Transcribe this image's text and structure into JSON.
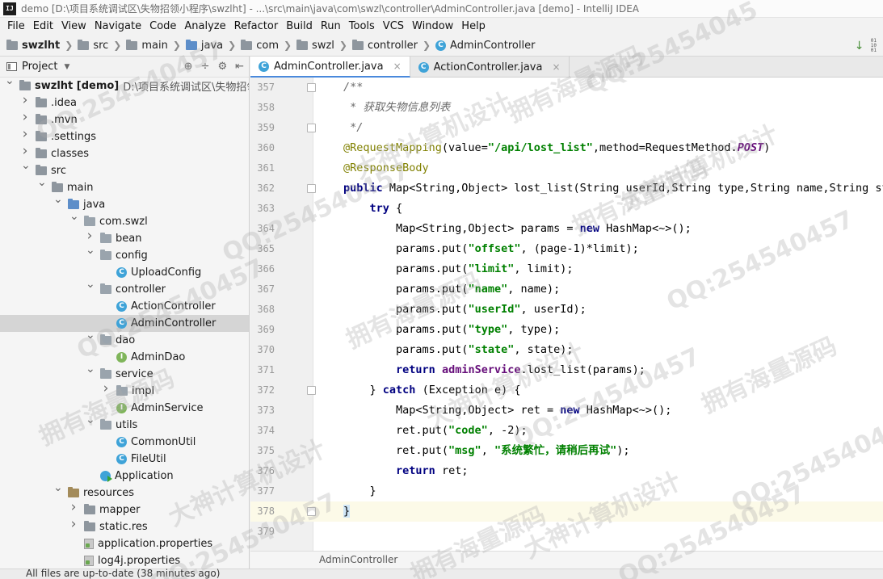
{
  "titlebar": {
    "app_icon": "IJ",
    "title": "demo [D:\\项目系统调试区\\失物招领小程序\\swzlht] - ...\\src\\main\\java\\com\\swzl\\controller\\AdminController.java [demo] - IntelliJ IDEA"
  },
  "menu": [
    "File",
    "Edit",
    "View",
    "Navigate",
    "Code",
    "Analyze",
    "Refactor",
    "Build",
    "Run",
    "Tools",
    "VCS",
    "Window",
    "Help"
  ],
  "breadcrumbs": [
    "swzlht",
    "src",
    "main",
    "java",
    "com",
    "swzl",
    "controller",
    "AdminController"
  ],
  "project_panel": {
    "title": "Project",
    "tree": [
      {
        "label": "swzlht [demo]",
        "path": "D:\\项目系统调试区\\失物招领小程",
        "icon": "folder",
        "depth": 0,
        "arrow": "down"
      },
      {
        "label": ".idea",
        "icon": "folder",
        "depth": 1,
        "arrow": "right"
      },
      {
        "label": ".mvn",
        "icon": "folder",
        "depth": 1,
        "arrow": "right"
      },
      {
        "label": ".settings",
        "icon": "folder",
        "depth": 1,
        "arrow": "right"
      },
      {
        "label": "classes",
        "icon": "folder",
        "depth": 1,
        "arrow": "right"
      },
      {
        "label": "src",
        "icon": "folder",
        "depth": 1,
        "arrow": "down"
      },
      {
        "label": "main",
        "icon": "folder",
        "depth": 2,
        "arrow": "down"
      },
      {
        "label": "java",
        "icon": "folder-blue",
        "depth": 3,
        "arrow": "down"
      },
      {
        "label": "com.swzl",
        "icon": "package",
        "depth": 4,
        "arrow": "down"
      },
      {
        "label": "bean",
        "icon": "package",
        "depth": 5,
        "arrow": "right"
      },
      {
        "label": "config",
        "icon": "package",
        "depth": 5,
        "arrow": "down"
      },
      {
        "label": "UploadConfig",
        "icon": "class",
        "depth": 6,
        "arrow": ""
      },
      {
        "label": "controller",
        "icon": "package",
        "depth": 5,
        "arrow": "down"
      },
      {
        "label": "ActionController",
        "icon": "class",
        "depth": 6,
        "arrow": ""
      },
      {
        "label": "AdminController",
        "icon": "class",
        "depth": 6,
        "arrow": "",
        "selected": true
      },
      {
        "label": "dao",
        "icon": "package",
        "depth": 5,
        "arrow": "down"
      },
      {
        "label": "AdminDao",
        "icon": "interface",
        "depth": 6,
        "arrow": ""
      },
      {
        "label": "service",
        "icon": "package",
        "depth": 5,
        "arrow": "down"
      },
      {
        "label": "impl",
        "icon": "package",
        "depth": 6,
        "arrow": "right"
      },
      {
        "label": "AdminService",
        "icon": "interface",
        "depth": 6,
        "arrow": ""
      },
      {
        "label": "utils",
        "icon": "package",
        "depth": 5,
        "arrow": "down"
      },
      {
        "label": "CommonUtil",
        "icon": "class",
        "depth": 6,
        "arrow": ""
      },
      {
        "label": "FileUtil",
        "icon": "class",
        "depth": 6,
        "arrow": ""
      },
      {
        "label": "Application",
        "icon": "application",
        "depth": 5,
        "arrow": ""
      },
      {
        "label": "resources",
        "icon": "folder-res",
        "depth": 3,
        "arrow": "down"
      },
      {
        "label": "mapper",
        "icon": "folder",
        "depth": 4,
        "arrow": "right"
      },
      {
        "label": "static.res",
        "icon": "folder",
        "depth": 4,
        "arrow": "right"
      },
      {
        "label": "application.properties",
        "icon": "properties",
        "depth": 4,
        "arrow": ""
      },
      {
        "label": "log4j.properties",
        "icon": "properties",
        "depth": 4,
        "arrow": ""
      }
    ]
  },
  "tabs": [
    {
      "label": "AdminController.java",
      "active": true
    },
    {
      "label": "ActionController.java",
      "active": false
    }
  ],
  "code_lines": [
    {
      "n": "357",
      "fold": true,
      "tokens": [
        [
          "c",
          "/**"
        ]
      ]
    },
    {
      "n": "358",
      "tokens": [
        [
          "c",
          " * 获取失物信息列表"
        ]
      ]
    },
    {
      "n": "359",
      "fold": true,
      "tokens": [
        [
          "c",
          " */"
        ]
      ]
    },
    {
      "n": "360",
      "tokens": [
        [
          "a",
          "@RequestMapping"
        ],
        [
          "p",
          "(value="
        ],
        [
          "s",
          "\"/api/lost_list\""
        ],
        [
          "p",
          ",method=RequestMethod."
        ],
        [
          "k2",
          "POST"
        ],
        [
          "p",
          ")"
        ]
      ]
    },
    {
      "n": "361",
      "tokens": [
        [
          "a",
          "@ResponseBody"
        ]
      ]
    },
    {
      "n": "362",
      "fold": true,
      "tokens": [
        [
          "k",
          "public "
        ],
        [
          "p",
          "Map<String,Object> lost_list(String userId,String type,String name,String state,Integer page,Integer limit){"
        ]
      ]
    },
    {
      "n": "363",
      "tokens": [
        [
          "p",
          "    "
        ],
        [
          "k",
          "try "
        ],
        [
          "p",
          "{"
        ]
      ]
    },
    {
      "n": "364",
      "tokens": [
        [
          "p",
          "        Map<String,Object> params = "
        ],
        [
          "k",
          "new "
        ],
        [
          "p",
          "HashMap<~>();"
        ]
      ]
    },
    {
      "n": "365",
      "tokens": [
        [
          "p",
          "        params.put("
        ],
        [
          "s",
          "\"offset\""
        ],
        [
          "p",
          ", (page-1)*limit);"
        ]
      ]
    },
    {
      "n": "366",
      "tokens": [
        [
          "p",
          "        params.put("
        ],
        [
          "s",
          "\"limit\""
        ],
        [
          "p",
          ", limit);"
        ]
      ]
    },
    {
      "n": "367",
      "tokens": [
        [
          "p",
          "        params.put("
        ],
        [
          "s",
          "\"name\""
        ],
        [
          "p",
          ", name);"
        ]
      ]
    },
    {
      "n": "368",
      "tokens": [
        [
          "p",
          "        params.put("
        ],
        [
          "s",
          "\"userId\""
        ],
        [
          "p",
          ", userId);"
        ]
      ]
    },
    {
      "n": "369",
      "tokens": [
        [
          "p",
          "        params.put("
        ],
        [
          "s",
          "\"type\""
        ],
        [
          "p",
          ", type);"
        ]
      ]
    },
    {
      "n": "370",
      "tokens": [
        [
          "p",
          "        params.put("
        ],
        [
          "s",
          "\"state\""
        ],
        [
          "p",
          ", state);"
        ]
      ]
    },
    {
      "n": "371",
      "tokens": [
        [
          "p",
          "        "
        ],
        [
          "k",
          "return "
        ],
        [
          "f",
          "adminService"
        ],
        [
          "p",
          ".lost_list(params);"
        ]
      ]
    },
    {
      "n": "372",
      "fold": true,
      "tokens": [
        [
          "p",
          "    } "
        ],
        [
          "k",
          "catch "
        ],
        [
          "p",
          "(Exception e) {"
        ]
      ]
    },
    {
      "n": "373",
      "tokens": [
        [
          "p",
          "        Map<String,Object> ret = "
        ],
        [
          "k",
          "new "
        ],
        [
          "p",
          "HashMap<~>();"
        ]
      ]
    },
    {
      "n": "374",
      "tokens": [
        [
          "p",
          "        ret.put("
        ],
        [
          "s",
          "\"code\""
        ],
        [
          "p",
          ", -2);"
        ]
      ]
    },
    {
      "n": "375",
      "tokens": [
        [
          "p",
          "        ret.put("
        ],
        [
          "s",
          "\"msg\""
        ],
        [
          "p",
          ", "
        ],
        [
          "s",
          "\"系统繁忙，请稍后再试\""
        ],
        [
          "p",
          ");"
        ]
      ]
    },
    {
      "n": "376",
      "tokens": [
        [
          "p",
          "        "
        ],
        [
          "k",
          "return "
        ],
        [
          "p",
          "ret;"
        ]
      ]
    },
    {
      "n": "377",
      "tokens": [
        [
          "p",
          "    }"
        ]
      ]
    },
    {
      "n": "378",
      "fold": true,
      "caret": true,
      "tokens": [
        [
          "b",
          "}"
        ]
      ]
    },
    {
      "n": "379",
      "tokens": []
    }
  ],
  "editor_breadcrumb": "AdminController",
  "status": "All files are up-to-date (38 minutes ago)",
  "watermarks": [
    "QQ:25454045",
    "大神计算机设计",
    "拥有海量源码",
    "QQ:254540457",
    "拥有海量源码",
    "QQ:254540457",
    "大神计算机设计",
    "拥有海量源码",
    "QQ:254540457",
    "QQ:254540457",
    "拥有海量源码",
    "大神计算机设计",
    "QQ:254540457",
    "拥有海量源码",
    "QQ:25454045",
    "大神计算机设计",
    "拥有海量源码",
    "QQ:254540457",
    "大神计算机设计",
    "QQ:254540457"
  ]
}
